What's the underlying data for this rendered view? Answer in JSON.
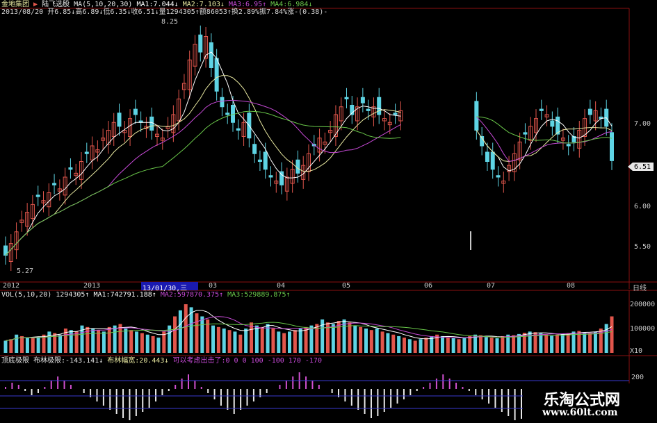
{
  "header": {
    "stock": "金地集团",
    "indicator": "陆飞选股",
    "ma_label": "MA(5,10,20,30)",
    "ma1": "MA1:7.044↓",
    "ma2": "MA2:7.103↓",
    "ma3": "MA3:6.95↑",
    "ma4": "MA4:6.984↓",
    "quote_line": "2013/08/20 开6.85↓高6.89↓低6.35↓收6.51↓量1294305↑额86053↑换2.89%振7.84%涨-(0.38)-"
  },
  "price_axis": {
    "labels": [
      "7.00",
      "6.51",
      "6.00",
      "5.50"
    ],
    "values": [
      7.0,
      6.51,
      6.0,
      5.5
    ]
  },
  "annotations": {
    "high": "8.25",
    "low": "5.27",
    "current": "6.51",
    "cursor_date": "13/01/30,三"
  },
  "time_axis": {
    "labels": [
      "2012",
      "2013",
      "03",
      "04",
      "05",
      "06",
      "07",
      "08"
    ],
    "period": "日线"
  },
  "volume": {
    "title": "VOL(5,10,20)",
    "value": "1294305↑",
    "ma1": "MA1:742791.188↑",
    "ma2": "MA2:597870.375↑",
    "ma3": "MA3:529889.875↑",
    "axis": [
      "200000",
      "100000",
      "X10"
    ]
  },
  "indicator": {
    "title": "顶底极限",
    "l1": "布林极限:-143.141↓",
    "l2": "布林幅宽:20.443↓",
    "l3": "可以考虑出击了:0 0 0 100 -100 170 -170",
    "axis": [
      "200"
    ]
  },
  "watermark": {
    "title": "乐淘公式网",
    "url": "www.60lt.com"
  },
  "colors": {
    "up": "#e2564c",
    "down": "#5ed4e4",
    "ma1": "#ffffff",
    "ma2": "#e8e8a0",
    "ma3": "#c84ad8",
    "ma4": "#6ac84a",
    "grid": "#8a1010"
  },
  "chart_data": {
    "type": "candlestick",
    "ylim": [
      5.1,
      8.3
    ],
    "candles_note": "daily OHLC approximated from image",
    "close": [
      5.3,
      5.45,
      5.6,
      5.75,
      5.85,
      5.95,
      6.05,
      6.0,
      6.1,
      6.2,
      6.15,
      6.3,
      6.4,
      6.35,
      6.5,
      6.6,
      6.7,
      6.65,
      6.8,
      6.9,
      7.0,
      6.95,
      6.9,
      7.05,
      7.1,
      7.0,
      6.95,
      6.9,
      6.85,
      6.8,
      6.95,
      7.1,
      7.3,
      7.5,
      7.8,
      8.0,
      7.9,
      8.1,
      7.7,
      7.4,
      7.2,
      7.1,
      7.0,
      6.9,
      7.0,
      6.8,
      6.6,
      6.5,
      6.4,
      6.3,
      6.25,
      6.2,
      6.3,
      6.4,
      6.35,
      6.45,
      6.6,
      6.7,
      6.8,
      6.75,
      6.9,
      7.1,
      7.2,
      7.3,
      7.1,
      7.2,
      7.25,
      7.15,
      7.2,
      7.1,
      7.05,
      7.0,
      7.1,
      7.15,
      null,
      null,
      null,
      null,
      null,
      null,
      null,
      null,
      null,
      null,
      null,
      null,
      null,
      6.9,
      6.7,
      6.5,
      6.4,
      6.3,
      6.25,
      6.45,
      6.6,
      6.75,
      6.85,
      6.95,
      7.05,
      7.15,
      7.1,
      6.95,
      6.85,
      6.8,
      6.7,
      6.75,
      6.9,
      7.05,
      7.1,
      7.15,
      7.05,
      6.95,
      6.51
    ],
    "volume": [
      40,
      45,
      60,
      55,
      50,
      48,
      52,
      60,
      70,
      65,
      60,
      80,
      75,
      70,
      90,
      85,
      80,
      75,
      70,
      85,
      90,
      95,
      80,
      75,
      70,
      65,
      60,
      55,
      50,
      70,
      90,
      120,
      140,
      160,
      150,
      130,
      120,
      110,
      90,
      85,
      80,
      75,
      70,
      60,
      80,
      100,
      90,
      85,
      95,
      80,
      70,
      65,
      70,
      75,
      80,
      85,
      90,
      95,
      110,
      100,
      95,
      105,
      110,
      100,
      90,
      85,
      80,
      75,
      80,
      70,
      65,
      60,
      55,
      50,
      45,
      40,
      45,
      50,
      55,
      60,
      55,
      50,
      48,
      45,
      50,
      55,
      60,
      58,
      52,
      50,
      48,
      55,
      60,
      58,
      62,
      66,
      70,
      68,
      64,
      60,
      58,
      60,
      62,
      65,
      70,
      72,
      68,
      66,
      70,
      80,
      95,
      120
    ],
    "indicator": [
      10,
      30,
      20,
      -10,
      -30,
      -20,
      10,
      40,
      60,
      40,
      20,
      0,
      -20,
      -40,
      -60,
      -80,
      -100,
      -120,
      -140,
      -150,
      -130,
      -110,
      -90,
      -60,
      -30,
      -10,
      20,
      50,
      70,
      40,
      10,
      -20,
      -50,
      -80,
      -100,
      -120,
      -100,
      -80,
      -60,
      -40,
      -20,
      0,
      20,
      40,
      60,
      80,
      60,
      40,
      20,
      0,
      -20,
      -40,
      -60,
      -80,
      -100,
      -120,
      -140,
      -130,
      -110,
      -90,
      -70,
      -50,
      -30,
      -10,
      10,
      30,
      50,
      70,
      50,
      30,
      10,
      -10,
      -30,
      -50,
      -70,
      -90,
      -110,
      -130,
      -150,
      -143
    ]
  }
}
